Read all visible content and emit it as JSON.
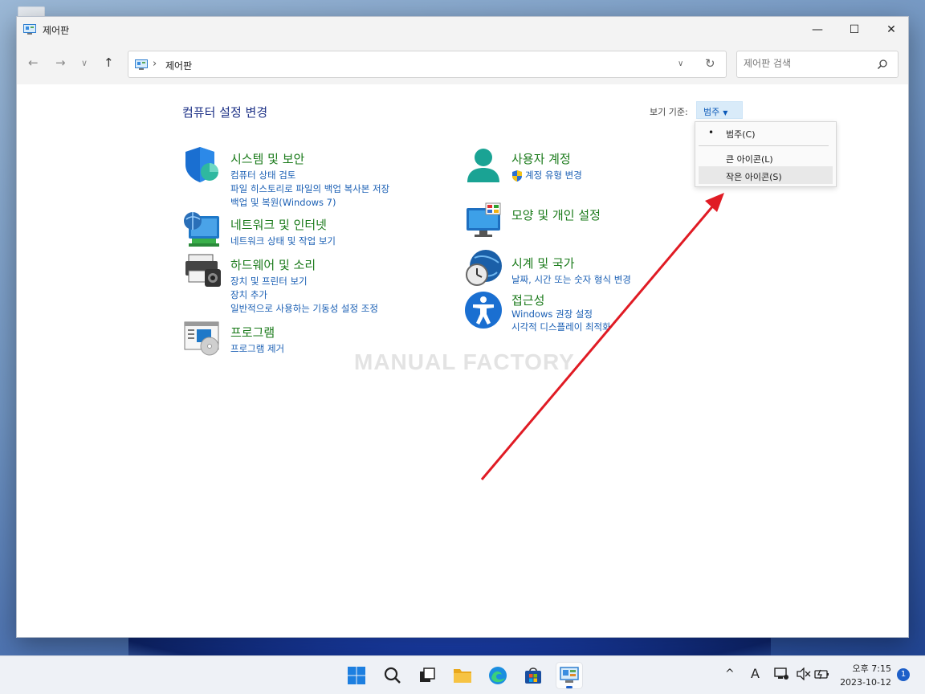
{
  "window": {
    "title": "제어판",
    "buttons": {
      "minimize": "—",
      "maximize": "☐",
      "close": "✕"
    }
  },
  "address": {
    "crumb": "제어판",
    "separator": "›"
  },
  "search": {
    "placeholder": "제어판 검색"
  },
  "page": {
    "title": "컴퓨터 설정 변경"
  },
  "view_by": {
    "label": "보기 기준:",
    "value": "범주",
    "menu": [
      {
        "label": "범주(C)",
        "selected": true
      },
      {
        "label": "큰 아이콘(L)",
        "selected": false
      },
      {
        "label": "작은 아이콘(S)",
        "selected": false,
        "hovered": true
      }
    ]
  },
  "categories_left": [
    {
      "title": "시스템 및 보안",
      "icon": "shield-icon",
      "links": [
        "컴퓨터 상태 검토",
        "파일 히스토리로 파일의 백업 복사본 저장",
        "백업 및 복원(Windows 7)"
      ]
    },
    {
      "title": "네트워크 및 인터넷",
      "icon": "network-icon",
      "links": [
        "네트워크 상태 및 작업 보기"
      ]
    },
    {
      "title": "하드웨어 및 소리",
      "icon": "printer-icon",
      "links": [
        "장치 및 프린터 보기",
        "장치 추가",
        "일반적으로 사용하는 기동성 설정 조정"
      ]
    },
    {
      "title": "프로그램",
      "icon": "programs-icon",
      "links": [
        "프로그램 제거"
      ]
    }
  ],
  "categories_right": [
    {
      "title": "사용자 계정",
      "icon": "user-icon",
      "links": [
        "계정 유형 변경"
      ]
    },
    {
      "title": "모양 및 개인 설정",
      "icon": "display-icon",
      "links": []
    },
    {
      "title": "시계 및 국가",
      "icon": "clock-globe-icon",
      "links": [
        "날짜, 시간 또는 숫자 형식 변경"
      ]
    },
    {
      "title": "접근성",
      "icon": "accessibility-icon",
      "links": [
        "Windows 권장 설정",
        "시각적 디스플레이 최적화"
      ]
    }
  ],
  "watermark": "MANUAL FACTORY",
  "colors": {
    "link": "#1a5fb4",
    "category": "#1a7a1a",
    "title": "#1e3287",
    "arrow": "#e01b24"
  },
  "taskbar": {
    "apps": [
      "windows-start-icon",
      "search-icon",
      "task-view-icon",
      "file-explorer-icon",
      "edge-icon",
      "store-icon",
      "control-panel-icon"
    ],
    "tray": {
      "chevron": "^",
      "ime": "A"
    },
    "time": "오후 7:15",
    "date": "2023-10-12",
    "notifications": "1"
  }
}
